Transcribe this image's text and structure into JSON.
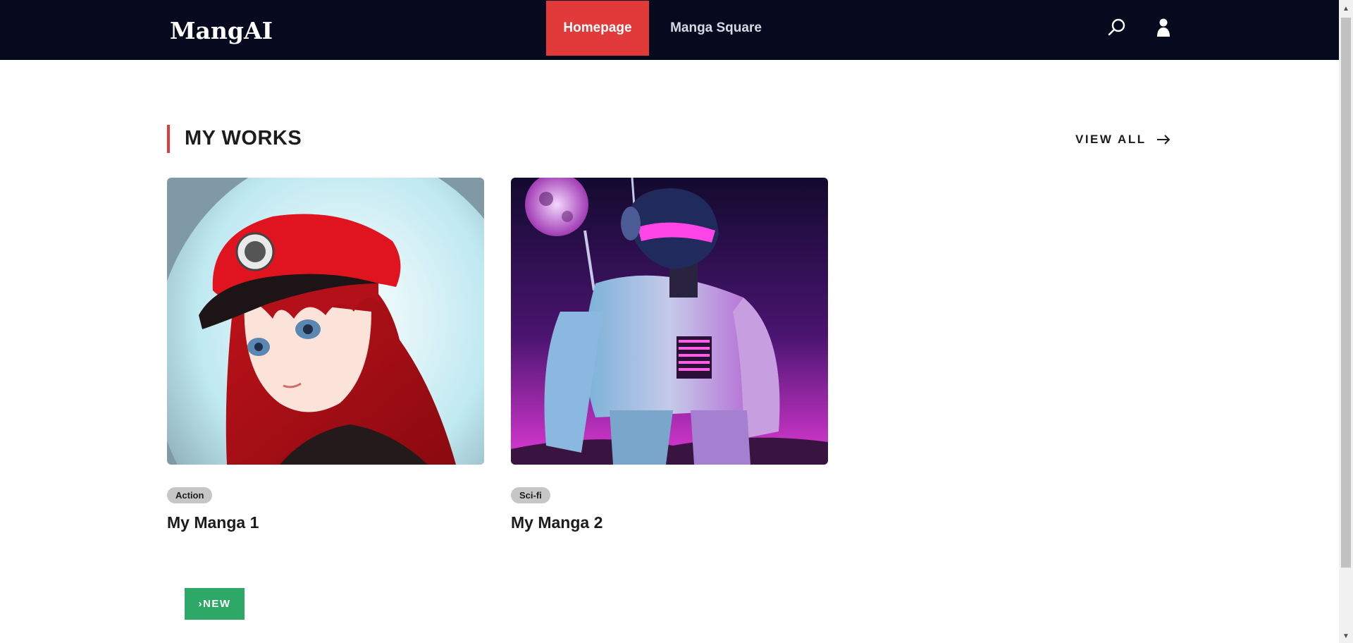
{
  "header": {
    "logo": "MangAI",
    "nav": [
      {
        "label": "Homepage",
        "active": true
      },
      {
        "label": "Manga Square",
        "active": false
      }
    ],
    "icons": [
      "search-icon",
      "user-icon"
    ],
    "bg_color": "#070a1f",
    "accent_color": "#e23a3a"
  },
  "section": {
    "title": "MY WORKS",
    "view_all": "VIEW ALL"
  },
  "works": [
    {
      "tag": "Action",
      "title": "My Manga 1",
      "image": "anime girl with red cap"
    },
    {
      "tag": "Sci-fi",
      "title": "My Manga 2",
      "image": "robot under purple moon"
    }
  ],
  "new_button": {
    "label": "›NEW",
    "color": "#2ea866"
  }
}
